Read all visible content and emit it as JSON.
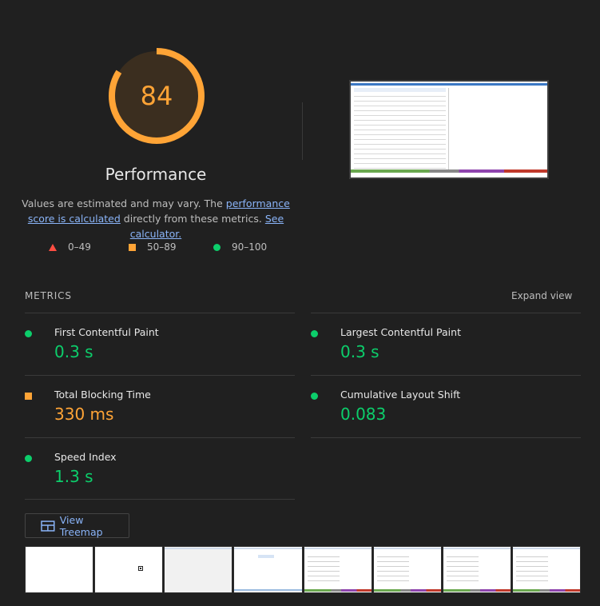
{
  "gauge": {
    "score": "84",
    "score_fraction": 0.84,
    "color": "#ffa436",
    "track_color": "#3b2e1f"
  },
  "title": "Performance",
  "description": {
    "text1": "Values are estimated and may vary. The ",
    "link1": "performance score is calculated",
    "text2": " directly from these metrics. ",
    "link2": "See calculator."
  },
  "legend": [
    {
      "shape": "triangle-icon",
      "label": "0–49",
      "color": "#ff4e42"
    },
    {
      "shape": "square-icon",
      "label": "50–89",
      "color": "#ffa436"
    },
    {
      "shape": "circle-icon",
      "label": "90–100",
      "color": "#0cce6b"
    }
  ],
  "metrics": {
    "heading": "METRICS",
    "expand_label": "Expand view",
    "items": [
      {
        "name": "First Contentful Paint",
        "value": "0.3 s",
        "status": "pass"
      },
      {
        "name": "Largest Contentful Paint",
        "value": "0.3 s",
        "status": "pass"
      },
      {
        "name": "Total Blocking Time",
        "value": "330 ms",
        "status": "average"
      },
      {
        "name": "Cumulative Layout Shift",
        "value": "0.083",
        "status": "pass"
      },
      {
        "name": "Speed Index",
        "value": "1.3 s",
        "status": "pass"
      }
    ]
  },
  "treemap_button": {
    "label": "View Treemap"
  },
  "colors": {
    "pass": "#0cce6b",
    "average": "#ffa436",
    "fail": "#ff4e42",
    "link": "#8ab4f8"
  }
}
